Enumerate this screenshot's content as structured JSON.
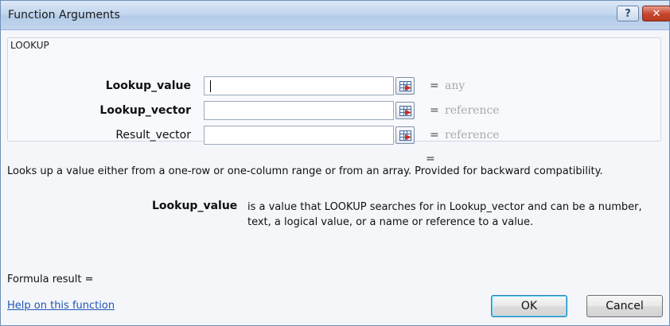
{
  "window": {
    "title": "Function Arguments",
    "help_glyph": "?",
    "close_glyph": "✕"
  },
  "group": {
    "function_name": "LOOKUP",
    "arguments": [
      {
        "label": "Lookup_value",
        "bold": true,
        "value": "",
        "equals": "=",
        "type": "any"
      },
      {
        "label": "Lookup_vector",
        "bold": true,
        "value": "",
        "equals": "=",
        "type": "reference"
      },
      {
        "label": "Result_vector",
        "bold": false,
        "value": "",
        "equals": "=",
        "type": "reference"
      }
    ]
  },
  "summary_equals": "=",
  "description": "Looks up a value either from a one-row or one-column range or from an array. Provided for backward compatibility.",
  "arg_help": {
    "name": "Lookup_value",
    "text": "is a value that LOOKUP searches for in Lookup_vector and can be a number, text, a logical value, or a name or reference to a value."
  },
  "formula_result": "Formula result =",
  "help_link": "Help on this function",
  "buttons": {
    "ok": "OK",
    "cancel": "Cancel"
  },
  "icons": {
    "refedit": "collapse-dialog-icon"
  },
  "colors": {
    "link": "#1f56b4",
    "type_hint": "#a9a9a9",
    "title_gradient": "#c3d6ee"
  }
}
